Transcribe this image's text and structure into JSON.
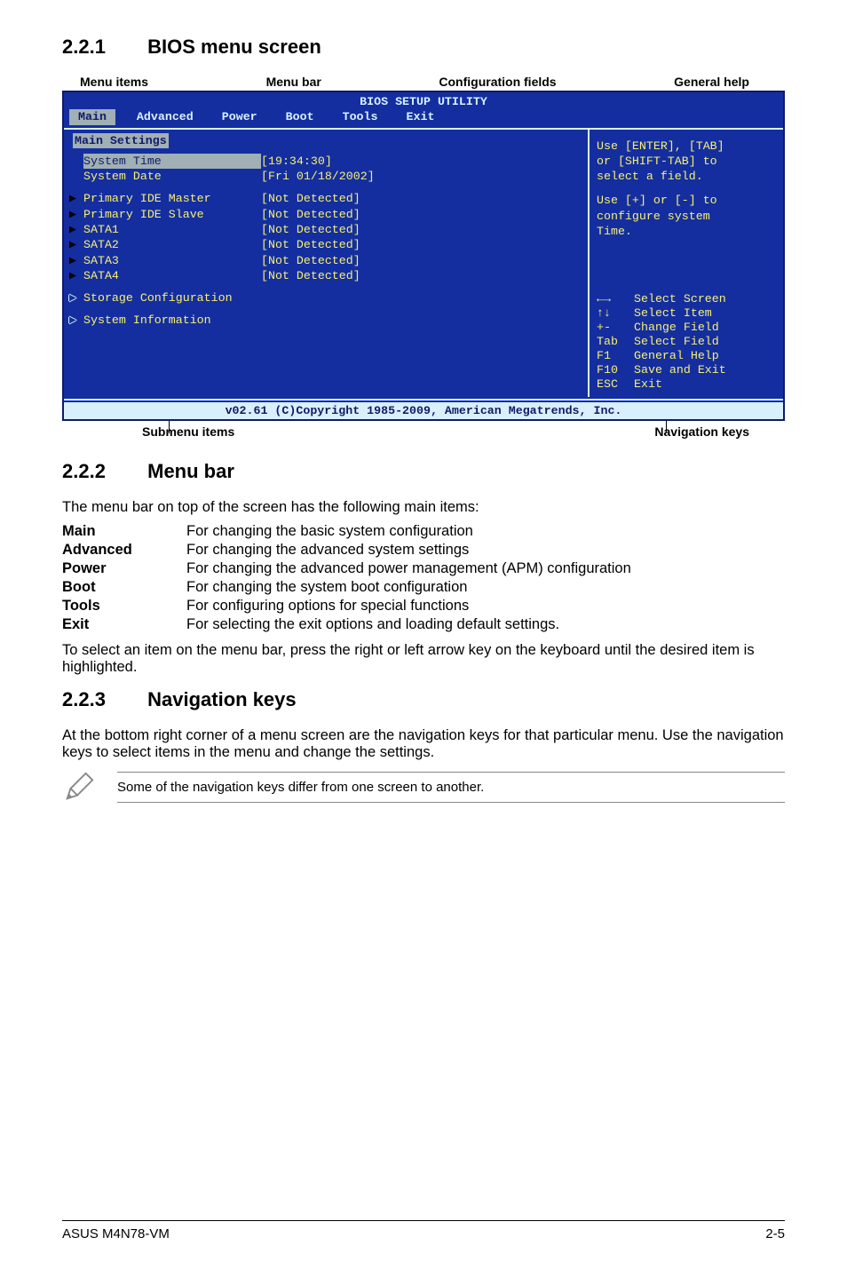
{
  "sections": {
    "s1": {
      "num": "2.2.1",
      "title": "BIOS menu screen"
    },
    "s2": {
      "num": "2.2.2",
      "title": "Menu bar"
    },
    "s3": {
      "num": "2.2.3",
      "title": "Navigation keys"
    }
  },
  "topLabels": {
    "menuItems": "Menu items",
    "menuBar": "Menu bar",
    "configFields": "Configuration fields",
    "generalHelp": "General help"
  },
  "bios": {
    "title": "BIOS SETUP UTILITY",
    "tabs": {
      "main": "Main",
      "advanced": "Advanced",
      "power": "Power",
      "boot": "Boot",
      "tools": "Tools",
      "exit": "Exit"
    },
    "mainSettings": "Main Settings",
    "systemTimeLabel": "System Time",
    "systemTimeVal": "[19:34:30]",
    "systemDateLabel": "System Date",
    "systemDateVal": "[Fri 01/18/2002]",
    "items": {
      "pideMaster": "Primary IDE Master",
      "pideSlave": "Primary IDE Slave",
      "sata1": "SATA1",
      "sata2": "SATA2",
      "sata3": "SATA3",
      "sata4": "SATA4",
      "storage": "Storage Configuration",
      "sysinfo": "System Information"
    },
    "notDetected": "[Not Detected]",
    "help1a": "Use [ENTER], [TAB]",
    "help1b": "or [SHIFT-TAB] to",
    "help1c": "select a field.",
    "help2a": "Use [+] or [-] to",
    "help2b": "configure system",
    "help2c": "Time.",
    "nav": {
      "arrowsLR": "←→",
      "selScreen": "Select Screen",
      "arrowsUD": "↑↓",
      "selItem": "Select Item",
      "pm": "+-",
      "chField": "Change Field",
      "tab": "Tab",
      "selField": "Select Field",
      "f1": "F1",
      "genHelp": "General Help",
      "f10": "F10",
      "saveExit": "Save and Exit",
      "esc": "ESC",
      "exit": "Exit"
    },
    "footer": "v02.61 (C)Copyright 1985-2009, American Megatrends, Inc."
  },
  "bottomLabels": {
    "submenu": "Submenu items",
    "navkeys": "Navigation keys"
  },
  "menubarText": "The menu bar on top of the screen has the following main items:",
  "defs": {
    "main": {
      "t": "Main",
      "d": "For changing the basic system configuration"
    },
    "adv": {
      "t": "Advanced",
      "d": "For changing the advanced system settings"
    },
    "pow": {
      "t": "Power",
      "d": "For changing the advanced power management (APM) configuration"
    },
    "boot": {
      "t": "Boot",
      "d": "For changing the system boot configuration"
    },
    "tools": {
      "t": "Tools",
      "d": "For configuring options for special functions"
    },
    "exit": {
      "t": "Exit",
      "d": "For selecting the exit options and loading default settings."
    }
  },
  "menubarPara": "To select an item on the menu bar, press the right or left arrow key on the keyboard until the desired item is highlighted.",
  "navkeysPara": "At the bottom right corner of a menu screen are the navigation keys for that particular menu. Use the navigation keys to select items in the menu and change the settings.",
  "noteText": "Some of the navigation keys differ from one screen to another.",
  "footerLeft": "ASUS M4N78-VM",
  "footerRight": "2-5"
}
